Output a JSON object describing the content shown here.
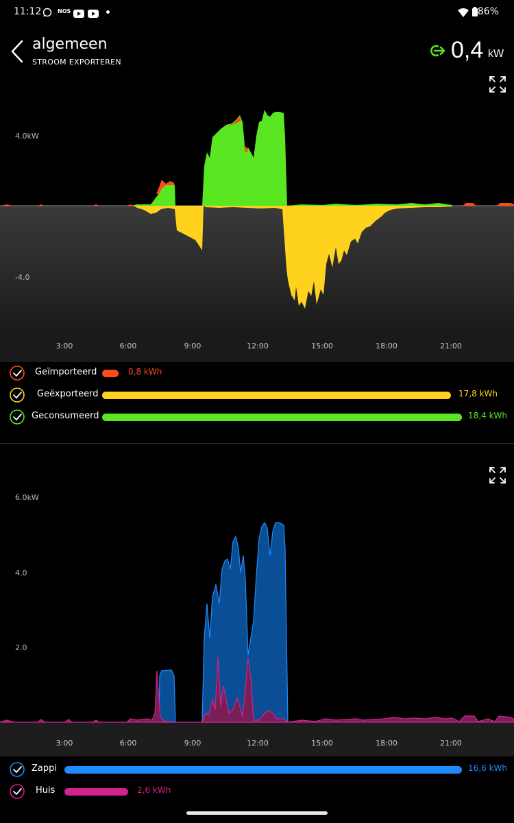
{
  "status_bar": {
    "time": "11:12",
    "icons": [
      "whatsapp-icon",
      "nos-icon",
      "youtube-icon",
      "youtube-icon",
      "dot-icon"
    ],
    "nos_label": "NOS",
    "battery": "86%"
  },
  "header": {
    "title": "algemeen",
    "subtitle": "STROOM EXPORTEREN",
    "power_value": "0,4",
    "power_unit": "kW",
    "power_icon": "export-arrow-icon"
  },
  "chart1": {
    "y_labels": [
      "4.0kW",
      "-4.0"
    ],
    "x_labels": [
      "3:00",
      "6:00",
      "9:00",
      "12:00",
      "15:00",
      "18:00",
      "21:00"
    ]
  },
  "legend1": [
    {
      "name": "Geïmporteerd",
      "value": "0,8 kWh",
      "fraction": 0.045,
      "color": "#ff4a1c"
    },
    {
      "name": "Geëxporteerd",
      "value": "17,8 kWh",
      "fraction": 0.97,
      "color": "#ffd21e"
    },
    {
      "name": "Geconsumeerd",
      "value": "18,4 kWh",
      "fraction": 1.0,
      "color": "#5ae620"
    }
  ],
  "chart2": {
    "y_labels": [
      "6.0kW",
      "4.0",
      "2.0"
    ],
    "x_labels": [
      "3:00",
      "6:00",
      "9:00",
      "12:00",
      "15:00",
      "18:00",
      "21:00"
    ]
  },
  "legend2": [
    {
      "name": "Zappi",
      "value": "16,6 kWh",
      "fraction": 1.0,
      "color": "#1e8cff"
    },
    {
      "name": "Huis",
      "value": "2,6 kWh",
      "fraction": 0.16,
      "color": "#d2228c"
    }
  ],
  "colors": {
    "imported": "#ff4a1c",
    "exported": "#ffd21e",
    "consumed": "#5ae620",
    "zappi": "#1e8cff",
    "huis": "#d2228c"
  }
}
